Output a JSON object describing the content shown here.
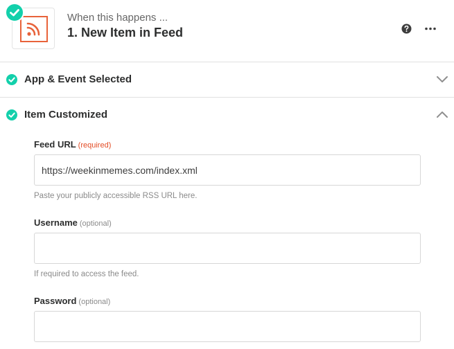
{
  "header": {
    "subtitle": "When this happens ...",
    "title": "1. New Item in Feed",
    "app_icon": "rss-feed-icon",
    "status_icon": "check-circle-icon",
    "help_icon": "question-circle-icon",
    "more_icon": "more-horizontal-icon"
  },
  "sections": {
    "app_event": {
      "label": "App & Event Selected",
      "state": "collapsed"
    },
    "item_customized": {
      "label": "Item Customized",
      "state": "expanded"
    }
  },
  "form": {
    "feed_url": {
      "label": "Feed URL",
      "tag": "(required)",
      "value": "https://weekinmemes.com/index.xml",
      "help": "Paste your publicly accessible RSS URL here."
    },
    "username": {
      "label": "Username",
      "tag": "(optional)",
      "value": "",
      "help": "If required to access the feed."
    },
    "password": {
      "label": "Password",
      "tag": "(optional)",
      "value": ""
    }
  },
  "colors": {
    "success": "#13d0ab",
    "rss_orange": "#e8623a",
    "required": "#e34c25"
  }
}
